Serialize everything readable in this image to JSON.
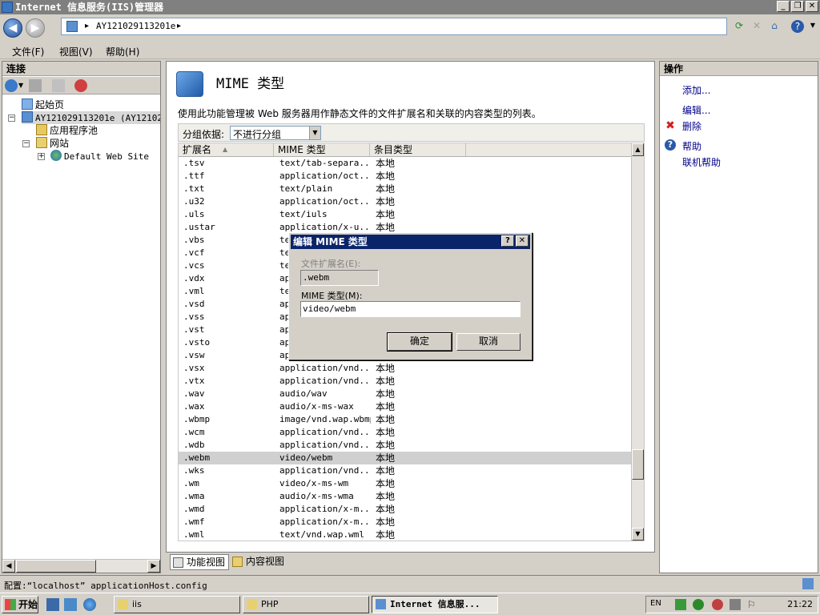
{
  "window": {
    "title": "Internet 信息服务(IIS)管理器"
  },
  "address": {
    "crumb": "AY121029113201e",
    "sep1": "▸",
    "sep2": "▸"
  },
  "menu": {
    "file": "文件(F)",
    "view": "视图(V)",
    "help": "帮助(H)"
  },
  "connections": {
    "header": "连接",
    "tree": {
      "start_page": "起始页",
      "server": "AY121029113201e (AY1210291",
      "app_pools": "应用程序池",
      "sites": "网站",
      "default_site": "Default Web Site"
    }
  },
  "center": {
    "title": "MIME 类型",
    "description": "使用此功能管理被 Web 服务器用作静态文件的文件扩展名和关联的内容类型的列表。",
    "group_label": "分组依据:",
    "group_value": "不进行分组",
    "columns": [
      "扩展名",
      "MIME 类型",
      "条目类型"
    ],
    "rows": [
      [
        ".tsv",
        "text/tab-separa...",
        "本地"
      ],
      [
        ".ttf",
        "application/oct...",
        "本地"
      ],
      [
        ".txt",
        "text/plain",
        "本地"
      ],
      [
        ".u32",
        "application/oct...",
        "本地"
      ],
      [
        ".uls",
        "text/iuls",
        "本地"
      ],
      [
        ".ustar",
        "application/x-u...",
        "本地"
      ],
      [
        ".vbs",
        "te",
        ""
      ],
      [
        ".vcf",
        "te",
        ""
      ],
      [
        ".vcs",
        "te",
        ""
      ],
      [
        ".vdx",
        "ap",
        ""
      ],
      [
        ".vml",
        "te",
        ""
      ],
      [
        ".vsd",
        "ap",
        ""
      ],
      [
        ".vss",
        "ap",
        ""
      ],
      [
        ".vst",
        "ap",
        ""
      ],
      [
        ".vsto",
        "ap",
        ""
      ],
      [
        ".vsw",
        "ap",
        ""
      ],
      [
        ".vsx",
        "application/vnd...",
        "本地"
      ],
      [
        ".vtx",
        "application/vnd...",
        "本地"
      ],
      [
        ".wav",
        "audio/wav",
        "本地"
      ],
      [
        ".wax",
        "audio/x-ms-wax",
        "本地"
      ],
      [
        ".wbmp",
        "image/vnd.wap.wbmp",
        "本地"
      ],
      [
        ".wcm",
        "application/vnd...",
        "本地"
      ],
      [
        ".wdb",
        "application/vnd...",
        "本地"
      ],
      [
        ".webm",
        "video/webm",
        "本地"
      ],
      [
        ".wks",
        "application/vnd...",
        "本地"
      ],
      [
        ".wm",
        "video/x-ms-wm",
        "本地"
      ],
      [
        ".wma",
        "audio/x-ms-wma",
        "本地"
      ],
      [
        ".wmd",
        "application/x-m...",
        "本地"
      ],
      [
        ".wmf",
        "application/x-m...",
        "本地"
      ],
      [
        ".wml",
        "text/vnd.wap.wml",
        "本地"
      ]
    ],
    "selected_row": 23,
    "view_tabs": {
      "features": "功能视图",
      "content": "内容视图"
    }
  },
  "actions": {
    "header": "操作",
    "add": "添加...",
    "edit": "编辑...",
    "delete": "删除",
    "help": "帮助",
    "online_help": "联机帮助"
  },
  "dialog": {
    "title": "编辑 MIME 类型",
    "help_btn": "?",
    "close_btn": "✕",
    "ext_label": "文件扩展名(E):",
    "ext_value": ".webm",
    "mime_label": "MIME 类型(M):",
    "mime_value": "video/webm",
    "ok": "确定",
    "cancel": "取消"
  },
  "status": {
    "text": "配置:“localhost” applicationHost.config"
  },
  "taskbar": {
    "start": "开始",
    "items": [
      "iis",
      "PHP",
      "Internet 信息服..."
    ],
    "lang": "EN",
    "clock": "21:22"
  },
  "colors": {
    "title_active": "#0a246a",
    "window_bg": "#d4d0c8",
    "link": "#00008b"
  }
}
